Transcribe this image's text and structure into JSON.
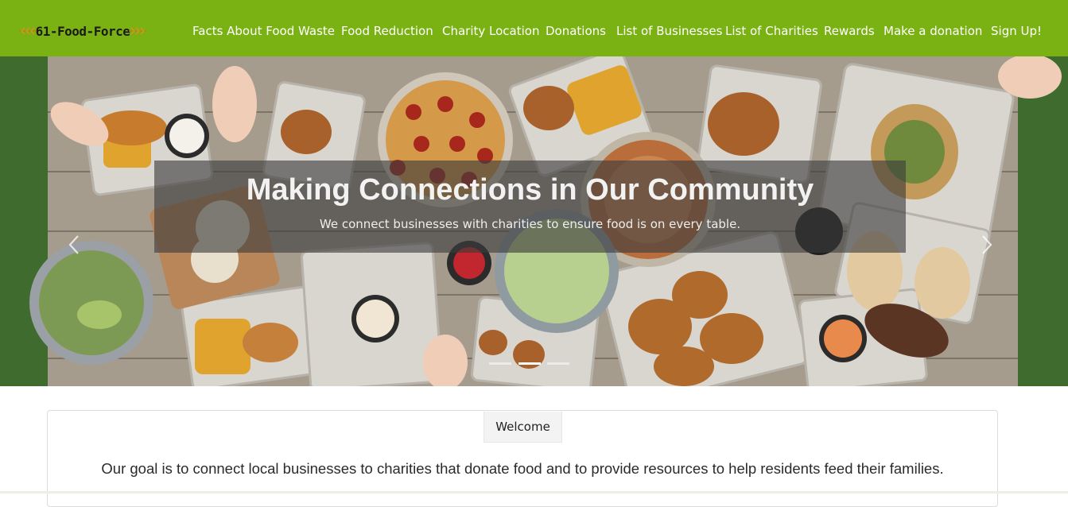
{
  "brand": {
    "name": "61-Food-Force"
  },
  "nav": {
    "links": [
      "Facts About Food Waste",
      "Food Reduction",
      "Charity Location",
      "Donations",
      "List of Businesses",
      "List of Charities",
      "Rewards",
      "Make a donation",
      "Sign Up!"
    ]
  },
  "hero": {
    "title": "Making Connections in Our Community",
    "subtitle": "We connect businesses with charities to ensure food is on every table.",
    "prev_icon": "chevron-left-icon",
    "next_icon": "chevron-right-icon",
    "slide_count": 3,
    "active_slide": 2
  },
  "welcome": {
    "tab_label": "Welcome",
    "body": "Our goal is to connect local businesses to charities that donate food and to provide resources to help residents feed their families."
  },
  "colors": {
    "navbar": "#7ab113",
    "nav_text": "#ffffff",
    "caption_bg": "rgba(60,60,60,0.62)"
  }
}
